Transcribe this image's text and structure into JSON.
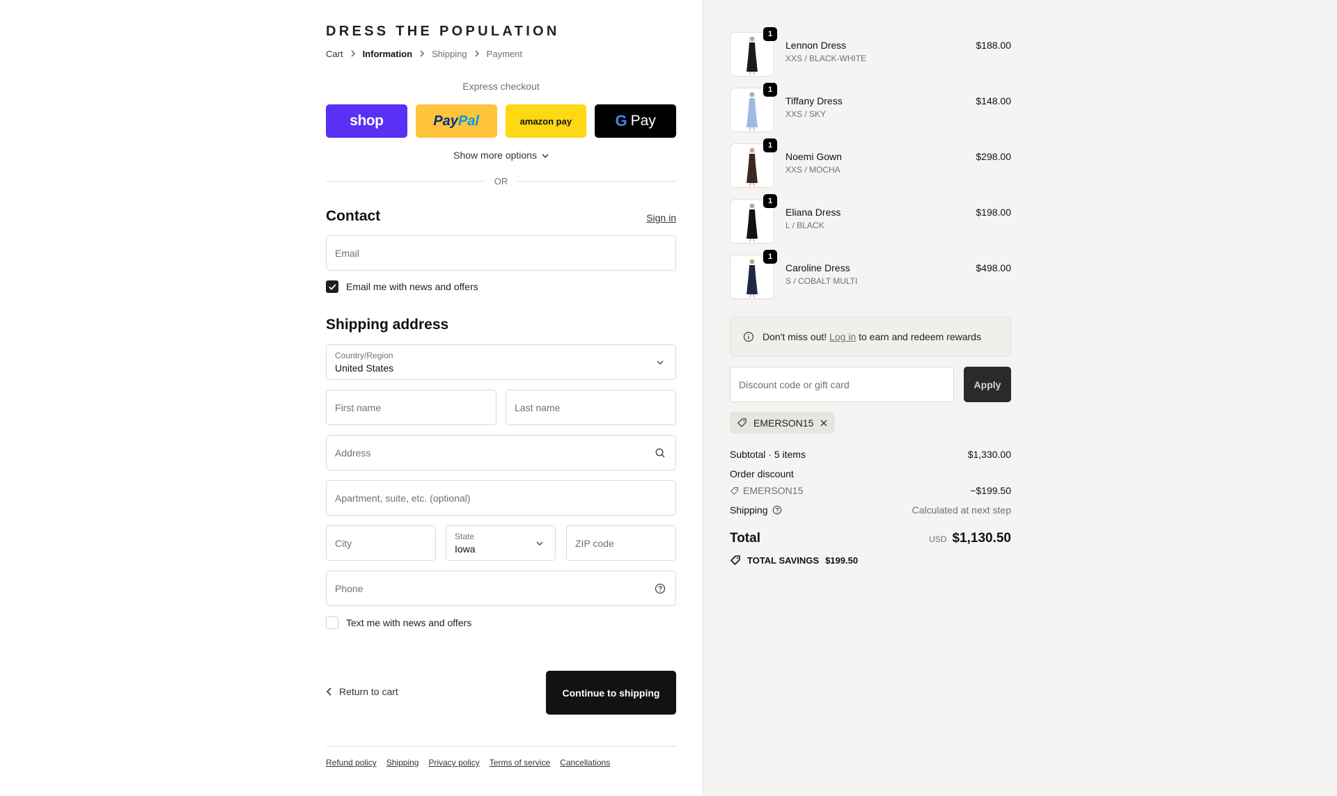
{
  "brand": "DRESS THE POPULATION",
  "breadcrumb": [
    "Cart",
    "Information",
    "Shipping",
    "Payment"
  ],
  "express": {
    "label": "Express checkout",
    "shop": "shop",
    "paypal_a": "Pay",
    "paypal_b": "Pal",
    "amazon": "amazon pay",
    "gpay_g": "G",
    "gpay": "Pay",
    "more": "Show more options",
    "or": "OR"
  },
  "contact": {
    "title": "Contact",
    "signin": "Sign in",
    "email_placeholder": "Email",
    "news_label": "Email me with news and offers",
    "news_checked": true
  },
  "shipping": {
    "title": "Shipping address",
    "country_label": "Country/Region",
    "country_value": "United States",
    "first_name": "First name",
    "last_name": "Last name",
    "address": "Address",
    "apartment": "Apartment, suite, etc. (optional)",
    "city": "City",
    "state_label": "State",
    "state_value": "Iowa",
    "zip": "ZIP code",
    "phone": "Phone",
    "text_label": "Text me with news and offers",
    "text_checked": false
  },
  "actions": {
    "return": "Return to cart",
    "continue": "Continue to shipping"
  },
  "footer": [
    "Refund policy",
    "Shipping",
    "Privacy policy",
    "Terms of service",
    "Cancellations"
  ],
  "items": [
    {
      "name": "Lennon Dress",
      "variant": "XXS / BLACK-WHITE",
      "price": "$188.00",
      "qty": "1",
      "color": "#1b1b1b"
    },
    {
      "name": "Tiffany Dress",
      "variant": "XXS / SKY",
      "price": "$148.00",
      "qty": "1",
      "color": "#9bbbe0"
    },
    {
      "name": "Noemi Gown",
      "variant": "XXS / MOCHA",
      "price": "$298.00",
      "qty": "1",
      "color": "#3b2a23"
    },
    {
      "name": "Eliana Dress",
      "variant": "L / BLACK",
      "price": "$198.00",
      "qty": "1",
      "color": "#121212"
    },
    {
      "name": "Caroline Dress",
      "variant": "S / COBALT MULTI",
      "price": "$498.00",
      "qty": "1",
      "color": "#1e2a44"
    }
  ],
  "rewards": {
    "pre": "Don't miss out!",
    "link": "Log in",
    "post": "to earn and redeem rewards"
  },
  "discount": {
    "placeholder": "Discount code or gift card",
    "apply": "Apply",
    "code": "EMERSON15"
  },
  "summary": {
    "subtotal_label": "Subtotal · 5 items",
    "subtotal": "$1,330.00",
    "order_discount": "Order discount",
    "discount_code": "EMERSON15",
    "discount_value": "−$199.50",
    "shipping_label": "Shipping",
    "shipping_value": "Calculated at next step",
    "total_label": "Total",
    "currency": "USD",
    "total": "$1,130.50",
    "savings_label": "TOTAL SAVINGS",
    "savings_value": "$199.50"
  }
}
